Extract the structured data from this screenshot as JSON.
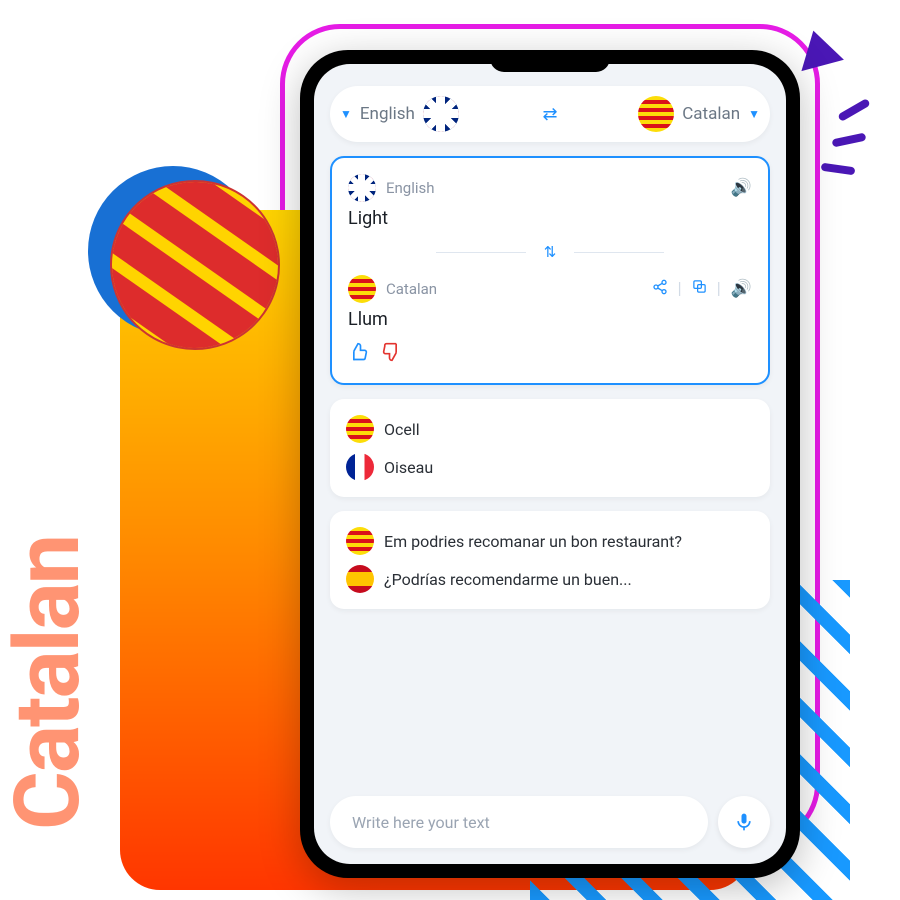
{
  "decor": {
    "label": "Catalan"
  },
  "header": {
    "source": "English",
    "target": "Catalan"
  },
  "main": {
    "source_lang": "English",
    "source_text": "Light",
    "target_lang": "Catalan",
    "target_text": "Llum"
  },
  "history": [
    {
      "from_text": "Ocell",
      "from_flag": "cat",
      "to_text": "Oiseau",
      "to_flag": "fr"
    },
    {
      "from_text": "Em podries recomanar un bon restaurant?",
      "from_flag": "cat",
      "to_text": "¿Podrías recomendarme un buen...",
      "to_flag": "es"
    }
  ],
  "input": {
    "placeholder": "Write here your text"
  }
}
